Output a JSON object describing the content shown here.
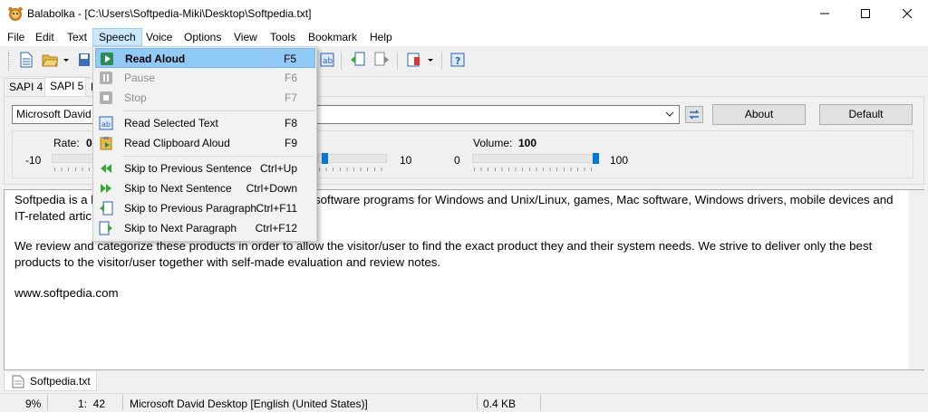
{
  "window": {
    "title": "Balabolka - [C:\\Users\\Softpedia-Miki\\Desktop\\Softpedia.txt]",
    "minimize_glyph": "—",
    "maximize_glyph": "☐",
    "close_glyph": "✕"
  },
  "menubar": {
    "items": [
      "File",
      "Edit",
      "Text",
      "Speech",
      "Voice",
      "Options",
      "View",
      "Tools",
      "Bookmark",
      "Help"
    ],
    "active": "Speech"
  },
  "sapi_tabs": {
    "items": [
      "SAPI 4",
      "SAPI 5",
      "M"
    ],
    "selected": "SAPI 5"
  },
  "voice": {
    "selected": "Microsoft David D",
    "about_label": "About",
    "default_label": "Default"
  },
  "params": {
    "rate_label": "Rate:",
    "rate_value": "0",
    "rate_min": "-10",
    "rate_fraction": 0.5,
    "pitch_max": "10",
    "pitch_fraction": 0.5,
    "volume_label": "Volume:",
    "volume_value": "100",
    "volume_min": "0",
    "volume_max": "100",
    "volume_fraction": 1.0
  },
  "editor": {
    "line1a": "Softpedia is a l",
    "line1b": "software programs for Windows and Unix/Linux, games, Mac software, Windows drivers, mobile devices and",
    "line2": "IT-related artic",
    "para2": "We review and categorize these products in order to allow the visitor/user to find the exact product they and their system needs. We strive to deliver only the best products to the visitor/user together with self-made evaluation and review notes.",
    "para3": "www.softpedia.com"
  },
  "file_tab": {
    "label": "Softpedia.txt"
  },
  "status": {
    "zoom": "9%",
    "position": "1:  42",
    "voice": "Microsoft David Desktop [English (United States)]",
    "size": "0.4 KB"
  },
  "speech_menu": {
    "items": [
      {
        "label": "Read Aloud",
        "shortcut": "F5",
        "icon": "play-icon",
        "enabled": true,
        "highlighted": true
      },
      {
        "label": "Pause",
        "shortcut": "F6",
        "icon": "pause-icon",
        "enabled": false
      },
      {
        "label": "Stop",
        "shortcut": "F7",
        "icon": "stop-icon",
        "enabled": false
      },
      {
        "label": "Read Selected Text",
        "shortcut": "F8",
        "icon": "read-selected-icon",
        "enabled": true
      },
      {
        "label": "Read Clipboard Aloud",
        "shortcut": "F9",
        "icon": "clipboard-icon",
        "enabled": true
      },
      {
        "label": "Skip to Previous Sentence",
        "shortcut": "Ctrl+Up",
        "icon": "skip-back-icon",
        "enabled": true
      },
      {
        "label": "Skip to Next Sentence",
        "shortcut": "Ctrl+Down",
        "icon": "skip-forward-icon",
        "enabled": true
      },
      {
        "label": "Skip to Previous Paragraph",
        "shortcut": "Ctrl+F11",
        "icon": "prev-paragraph-icon",
        "enabled": true
      },
      {
        "label": "Skip to Next Paragraph",
        "shortcut": "Ctrl+F12",
        "icon": "next-paragraph-icon",
        "enabled": true
      }
    ]
  },
  "colors": {
    "highlight": "#91c9f7",
    "accent": "#0078d7",
    "menu_active": "#cce8ff"
  }
}
